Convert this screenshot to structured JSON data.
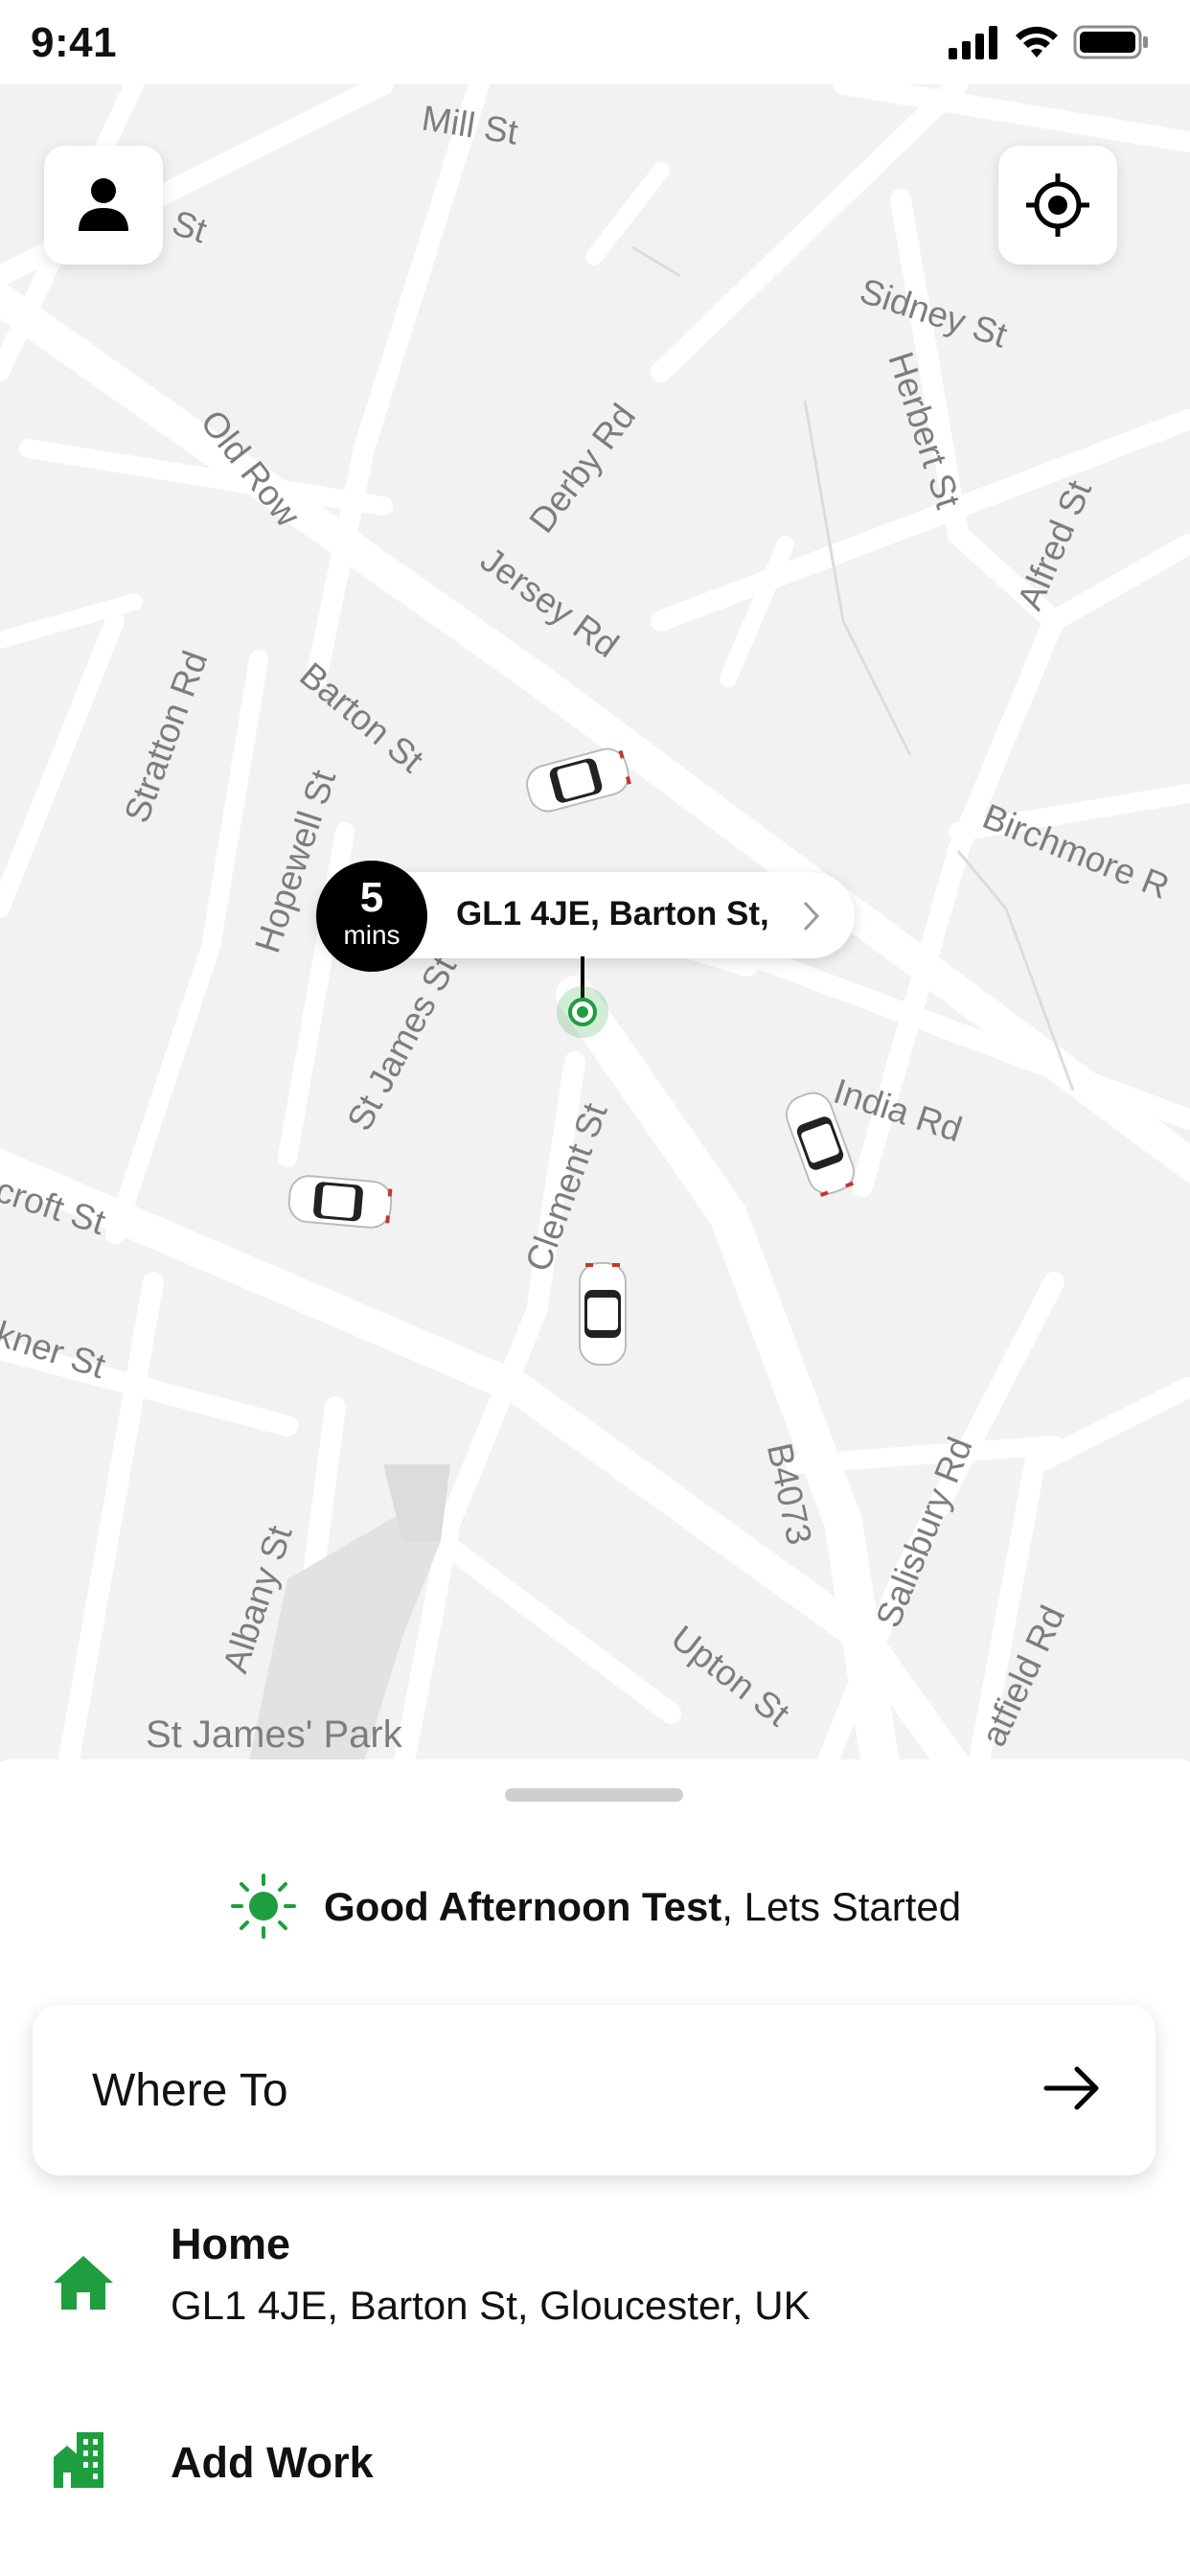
{
  "status_bar": {
    "time": "9:41"
  },
  "map": {
    "streets": [
      {
        "label": "Mill St"
      },
      {
        "label": "Sidney St"
      },
      {
        "label": "Old Row"
      },
      {
        "label": "Derby Rd"
      },
      {
        "label": "Jersey Rd"
      },
      {
        "label": "Herbert St"
      },
      {
        "label": "Alfred St"
      },
      {
        "label": "Stratton Rd"
      },
      {
        "label": "Barton St"
      },
      {
        "label": "Hopewell St"
      },
      {
        "label": "Birchmore R"
      },
      {
        "label": "St James St"
      },
      {
        "label": "India Rd"
      },
      {
        "label": "Clement St"
      },
      {
        "label": "croft St"
      },
      {
        "label": "kner St"
      },
      {
        "label": "B4073"
      },
      {
        "label": "Salisbury Rd"
      },
      {
        "label": "Albany St"
      },
      {
        "label": "Upton St"
      },
      {
        "label": "atfield Rd"
      },
      {
        "label": "St James' Park"
      },
      {
        "label": "on St"
      }
    ],
    "pickup": {
      "eta_value": "5",
      "eta_unit": "mins",
      "address": "GL1 4JE, Barton St,"
    }
  },
  "sheet": {
    "greeting_bold": "Good Afternoon Test",
    "greeting_rest": ", Lets Started",
    "where_to_label": "Where To",
    "saved_places": [
      {
        "title": "Home",
        "subtitle": "GL1 4JE, Barton St, Gloucester, UK",
        "icon": "home-icon"
      },
      {
        "title": "Add Work",
        "subtitle": "",
        "icon": "work-building-icon"
      }
    ]
  },
  "colors": {
    "accent_green": "#1e9e3e",
    "map_bg": "#f2f2f2",
    "road": "#ffffff"
  }
}
